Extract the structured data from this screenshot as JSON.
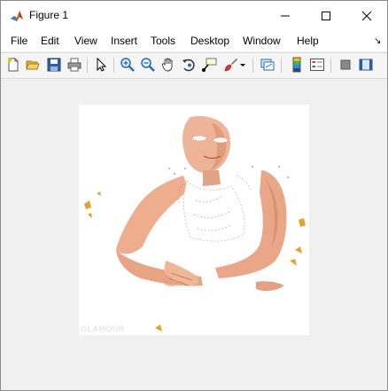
{
  "window": {
    "title": "Figure 1",
    "controls": {
      "minimize": "minimize",
      "maximize": "maximize",
      "close": "close"
    }
  },
  "menubar": {
    "items": [
      "File",
      "Edit",
      "View",
      "Insert",
      "Tools",
      "Desktop",
      "Window",
      "Help"
    ],
    "corner_glyph": "↘"
  },
  "toolbar": {
    "buttons": [
      "new-figure-icon",
      "open-file-icon",
      "save-icon",
      "print-icon",
      "pointer-icon",
      "zoom-in-icon",
      "zoom-out-icon",
      "pan-icon",
      "rotate-3d-icon",
      "data-cursor-icon",
      "brush-icon",
      "dropdown-arrow-icon",
      "link-plot-icon",
      "colorbar-icon",
      "legend-icon",
      "hide-plot-tools-icon",
      "show-plot-tools-icon"
    ]
  },
  "figure": {
    "image_description_icon": "photo-of-person-with-white-background",
    "watermark": "GLAMOUR"
  },
  "colors": {
    "window_bg": "#f0f0f0",
    "titlebar_bg": "#ffffff",
    "skin": "#e9a98a",
    "skin_shadow": "#d98e6a",
    "accent_orange": "#e8a030"
  }
}
